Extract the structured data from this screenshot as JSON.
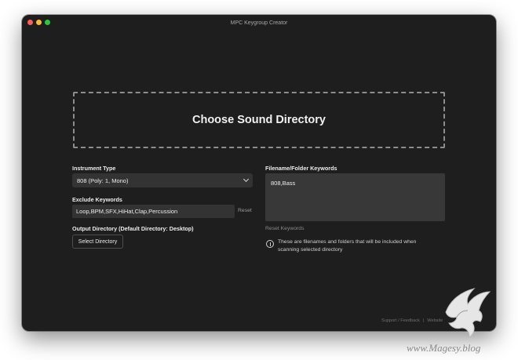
{
  "window": {
    "title": "MPC Keygroup Creator"
  },
  "dropzone": {
    "label": "Choose Sound Directory"
  },
  "instrument": {
    "label": "Instrument Type",
    "selected": "808 (Poly: 1, Mono)"
  },
  "exclude": {
    "label": "Exclude Keywords",
    "value": "Loop,BPM,SFX,HiHat,Clap,Percussion",
    "reset_label": "Reset"
  },
  "output": {
    "label": "Output Directory (Default Directory: Desktop)",
    "button_label": "Select Directory"
  },
  "keywords": {
    "label": "Filename/Folder Keywords",
    "value": "808,Bass",
    "reset_label": "Reset Keywords",
    "info": "These are filenames and folders that will be included when scanning selected directory"
  },
  "footer": {
    "support": "Support / Feedback",
    "website": "Website"
  },
  "watermark": {
    "text": "www.Magesy.blog"
  },
  "icons": {
    "info": "info-circle-icon",
    "chevron": "chevron-down-icon",
    "logo": "griffin-logo"
  },
  "colors": {
    "window_bg": "#1e1e1e",
    "field_bg": "#333333",
    "dashed_border": "#8d8d8d"
  }
}
